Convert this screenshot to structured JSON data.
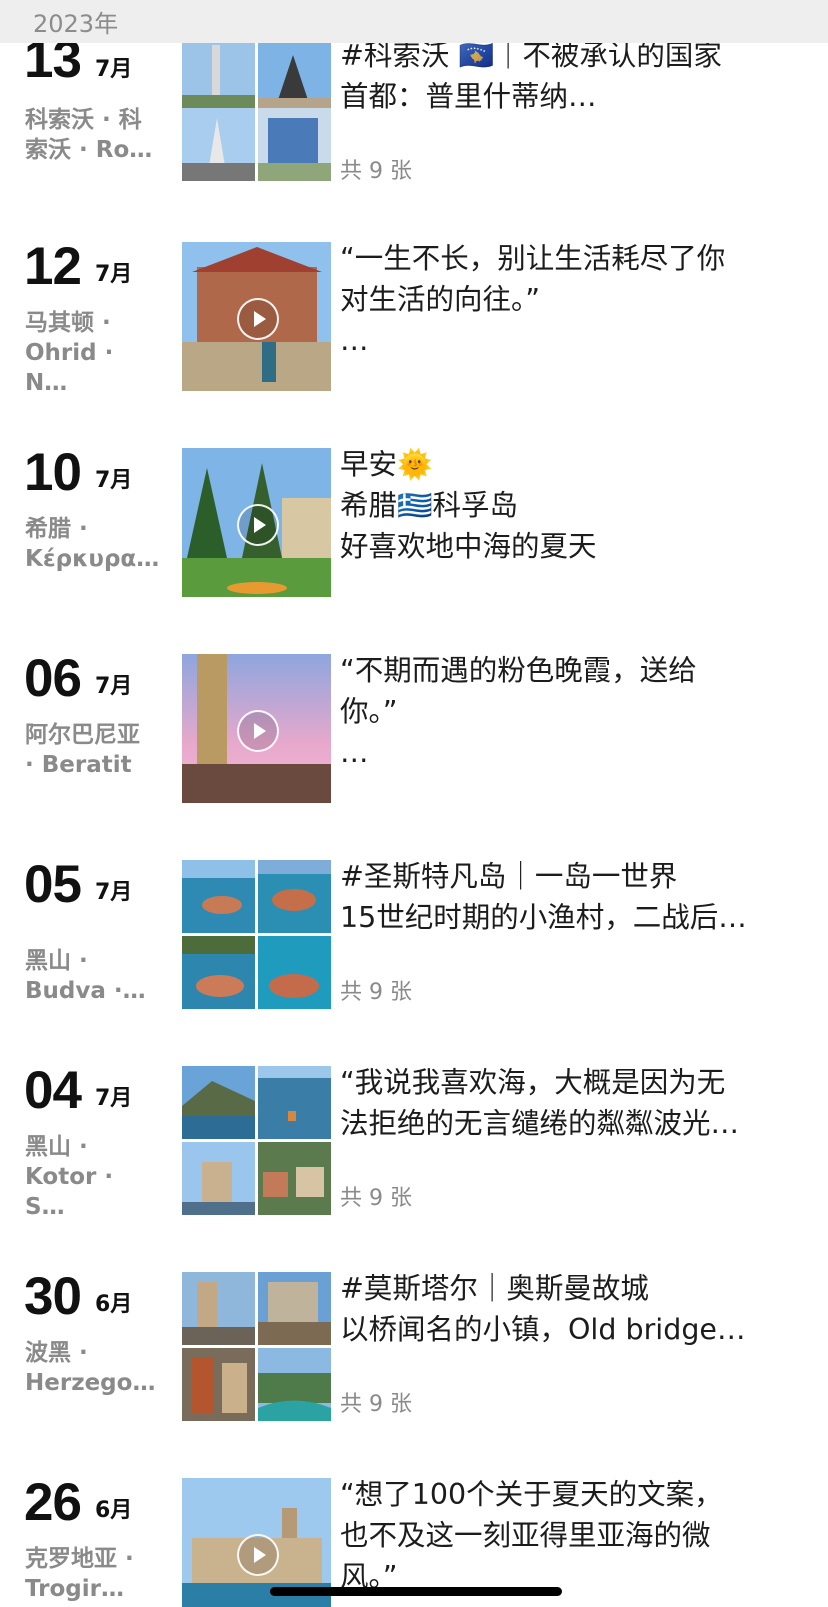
{
  "header": {
    "year": "2023年"
  },
  "entries": [
    {
      "day": "13",
      "month": "7月",
      "location": "科索沃 · 科\n索沃 · Ro…",
      "text": "#科索沃 🇽🇰｜不被承认的国家\n首都：普里什蒂纳…",
      "count": "共 9 张",
      "media": "grid",
      "icon": "kosovo-flag-icon"
    },
    {
      "day": "12",
      "month": "7月",
      "location": "马其顿 ·\nOhrid · N…",
      "text": "“一生不长，别让生活耗尽了你\n对生活的向往。”\n…",
      "count": "",
      "media": "video"
    },
    {
      "day": "10",
      "month": "7月",
      "location": "希腊 ·\nΚέρκυρα…",
      "text": "早安🌞\n希腊🇬🇷科孚岛\n好喜欢地中海的夏天",
      "count": "",
      "media": "video",
      "icon": "greece-flag-icon"
    },
    {
      "day": "06",
      "month": "7月",
      "location": "阿尔巴尼亚\n· Beratit",
      "text": "“不期而遇的粉色晚霞，送给\n你。”\n…",
      "count": "",
      "media": "video"
    },
    {
      "day": "05",
      "month": "7月",
      "location": "黑山 ·\nBudva ·…",
      "text": "#圣斯特凡岛｜一岛一世界\n15世纪时期的小渔村，二战后…",
      "count": "共 9 张",
      "media": "grid"
    },
    {
      "day": "04",
      "month": "7月",
      "location": "黑山 ·\nKotor · S…",
      "text": "“我说我喜欢海，大概是因为无\n法拒绝的无言缱绻的粼粼波光…",
      "count": "共 9 张",
      "media": "grid"
    },
    {
      "day": "30",
      "month": "6月",
      "location": "波黑 ·\nHerzego…",
      "text": "#莫斯塔尔｜奥斯曼故城\n以桥闻名的小镇，Old bridge…",
      "count": "共 9 张",
      "media": "grid"
    },
    {
      "day": "26",
      "month": "6月",
      "location": "克罗地亚 ·\nTrogir…",
      "text": "“想了100个关于夏天的文案，\n也不及这一刻亚得里亚海的微\n风。”",
      "count": "",
      "media": "video"
    }
  ],
  "colors": {
    "header_bg": "#eeeeee",
    "header_text": "#8c8c8c",
    "secondary_text": "#8a8a8a",
    "primary_text": "#1c1c1c"
  }
}
